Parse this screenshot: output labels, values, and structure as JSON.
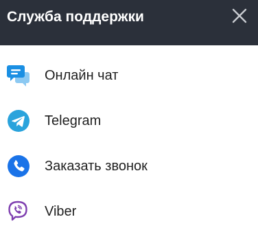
{
  "header": {
    "title": "Служба поддержки",
    "close_icon": "close-icon",
    "background": "#2b303a"
  },
  "items": [
    {
      "label": "Онлайн чат",
      "icon": "chat-bubbles-icon",
      "color": "#1a8fe3"
    },
    {
      "label": "Telegram",
      "icon": "telegram-icon",
      "color": "#2aa3dc"
    },
    {
      "label": "Заказать звонок",
      "icon": "phone-icon",
      "color": "#1a73e8"
    },
    {
      "label": "Viber",
      "icon": "viber-icon",
      "color": "#7d3daf"
    }
  ]
}
